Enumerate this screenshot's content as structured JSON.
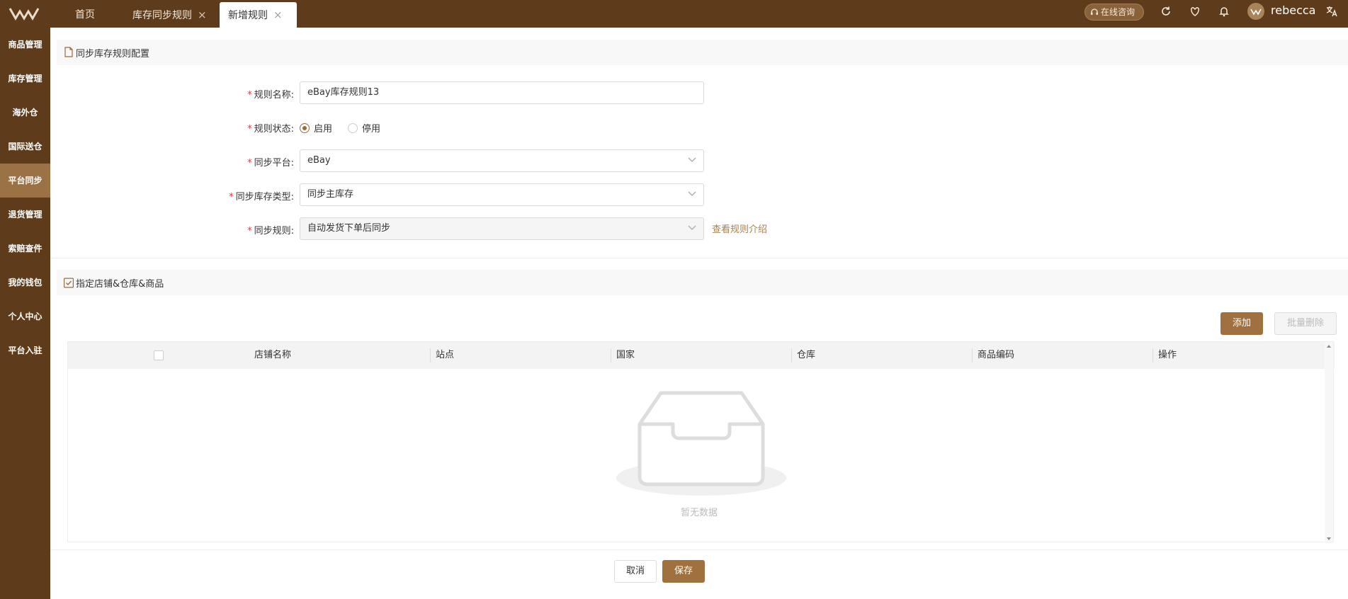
{
  "header": {
    "tabs": [
      {
        "label": "首页"
      },
      {
        "label": "库存同步规则",
        "closable": true
      },
      {
        "label": "新增规则",
        "closable": true,
        "active": true
      }
    ],
    "consult_label": "在线咨询",
    "username": "rebecca"
  },
  "sidebar": {
    "items": [
      {
        "label": "商品管理"
      },
      {
        "label": "库存管理"
      },
      {
        "label": "海外仓"
      },
      {
        "label": "国际送仓"
      },
      {
        "label": "平台同步",
        "active": true
      },
      {
        "label": "退货管理"
      },
      {
        "label": "索赔查件"
      },
      {
        "label": "我的钱包"
      },
      {
        "label": "个人中心"
      },
      {
        "label": "平台入驻"
      }
    ]
  },
  "config_section": {
    "title": "同步库存规则配置",
    "rule_name": {
      "label": "规则名称:",
      "value": "eBay库存规则13"
    },
    "rule_status": {
      "label": "规则状态:",
      "options": [
        "启用",
        "停用"
      ],
      "selected": "启用"
    },
    "platform": {
      "label": "同步平台:",
      "value": "eBay"
    },
    "stock_type": {
      "label": "同步库存类型:",
      "value": "同步主库存"
    },
    "sync_rule": {
      "label": "同步规则:",
      "value": "自动发货下单后同步",
      "link": "查看规则介绍"
    }
  },
  "store_section": {
    "title": "指定店铺&仓库&商品",
    "add_button": "添加",
    "batch_delete_button": "批量删除",
    "columns": [
      "店铺名称",
      "站点",
      "国家",
      "仓库",
      "商品编码",
      "操作"
    ],
    "rows": [],
    "empty_text": "暂无数据"
  },
  "footer": {
    "cancel": "取消",
    "save": "保存"
  },
  "colors": {
    "brand": "#5e3b1a",
    "accent": "#a0703f",
    "sidebar_active": "#9a7246",
    "required": "#e23b3b"
  }
}
